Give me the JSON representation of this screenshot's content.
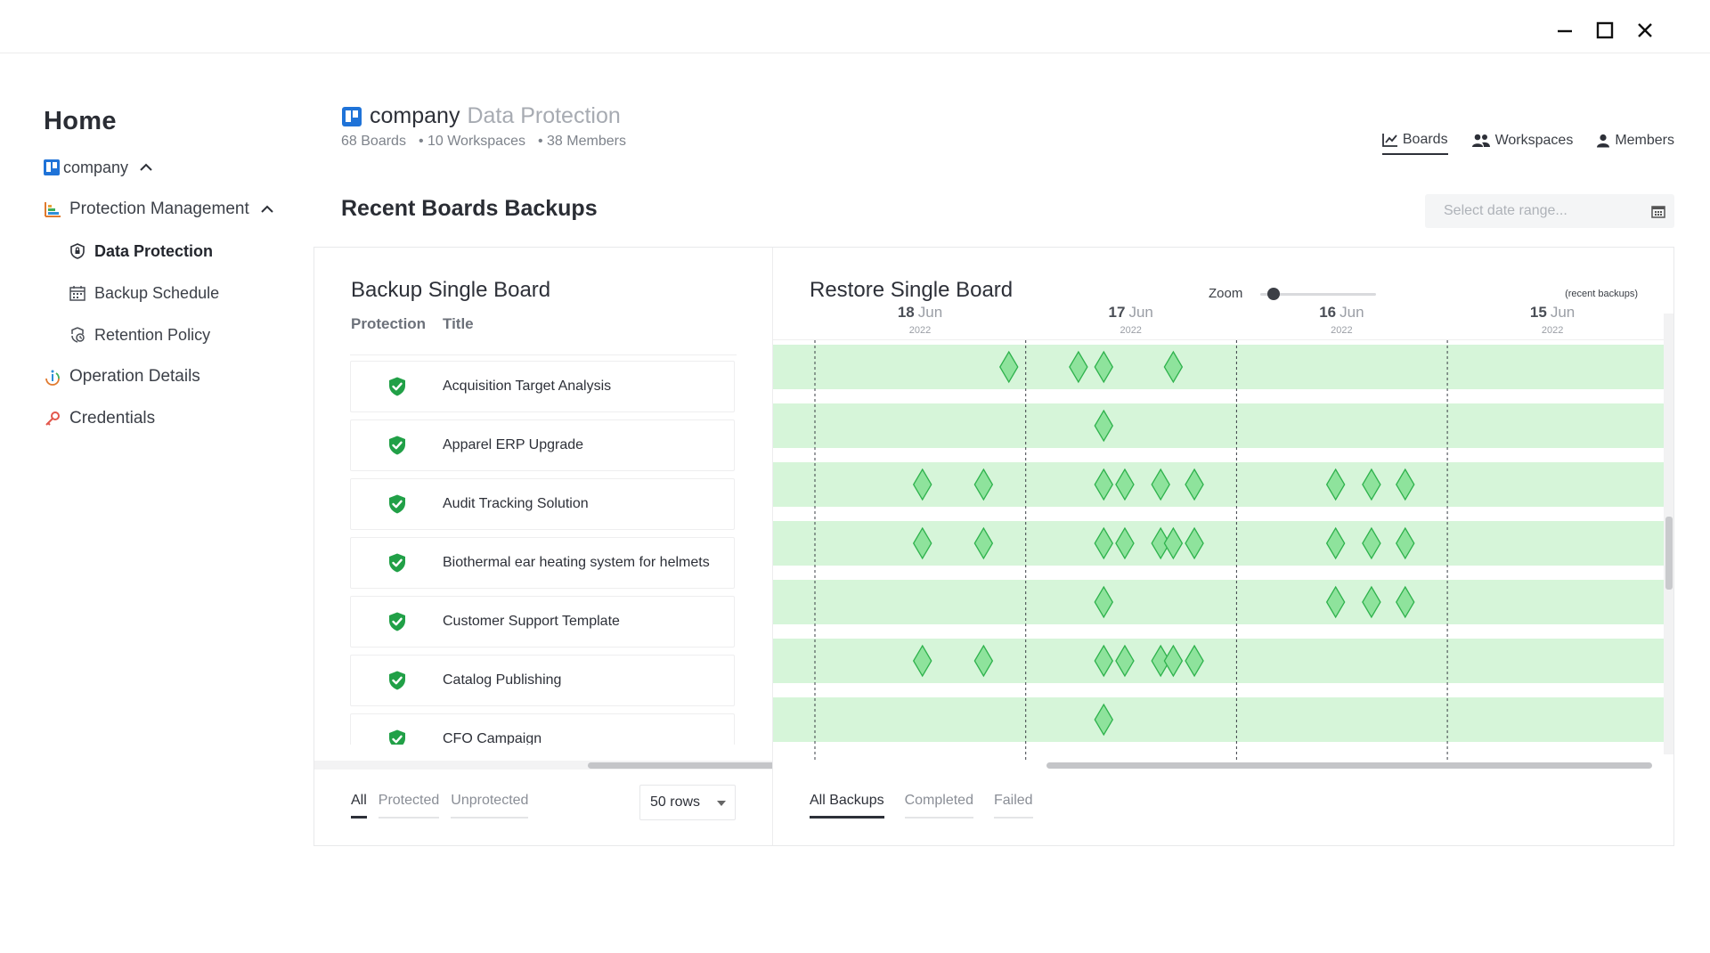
{
  "window": {
    "minimize_icon": "minimize-icon",
    "maximize_icon": "maximize-icon",
    "close_icon": "close-icon"
  },
  "sidebar": {
    "home": "Home",
    "company": "company",
    "protection_management": "Protection Management",
    "data_protection": "Data Protection",
    "backup_schedule": "Backup Schedule",
    "retention_policy": "Retention Policy",
    "operation_details": "Operation Details",
    "credentials": "Credentials"
  },
  "header": {
    "name": "company",
    "subtitle": "Data Protection",
    "boards": "68 Boards",
    "workspaces": "• 10 Workspaces",
    "members": "• 38 Members",
    "tabs": {
      "boards": "Boards",
      "workspaces": "Workspaces",
      "members": "Members"
    }
  },
  "section": {
    "title": "Recent Boards Backups",
    "date_placeholder": "Select date range..."
  },
  "backup": {
    "title": "Backup Single Board",
    "col_protection": "Protection",
    "col_title": "Title",
    "rows": [
      "Acquisition Target Analysis",
      "Apparel ERP Upgrade",
      "Audit Tracking Solution",
      "Biothermal ear heating system for helmets",
      "Customer Support Template",
      "Catalog Publishing",
      "CFO Campaign"
    ],
    "filters": {
      "all": "All",
      "protected": "Protected",
      "unprotected": "Unprotected"
    },
    "rows_per_page": "50 rows"
  },
  "restore": {
    "title": "Restore Single Board",
    "zoom_label": "Zoom",
    "zoom_level": 0.08,
    "recent_note": "(recent backups)",
    "dates": [
      {
        "day": "18",
        "mon": "Jun",
        "year": "2022"
      },
      {
        "day": "17",
        "mon": "Jun",
        "year": "2022"
      },
      {
        "day": "16",
        "mon": "Jun",
        "year": "2022"
      },
      {
        "day": "15",
        "mon": "Jun",
        "year": "2022"
      }
    ],
    "backup_marks": [
      [
        1.25,
        0.92,
        1.7,
        1.37
      ],
      [
        1.37
      ],
      [
        2.8,
        2.64,
        2.47,
        1.8,
        1.64,
        1.47,
        0.8,
        0.51,
        1.37
      ],
      [
        2.8,
        2.64,
        2.47,
        1.8,
        1.64,
        1.47,
        0.8,
        0.51,
        1.7,
        1.37
      ],
      [
        2.8,
        2.64,
        2.47,
        1.37
      ],
      [
        1.8,
        1.64,
        1.47,
        0.8,
        0.51,
        1.7,
        1.37
      ],
      [
        1.37
      ]
    ],
    "filters": {
      "all": "All Backups",
      "completed": "Completed",
      "failed": "Failed"
    },
    "colors": {
      "band": "#d6f5d9",
      "mark_fill": "#8ee39c",
      "mark_stroke": "#2fb24d",
      "shield": "#21a047"
    }
  }
}
